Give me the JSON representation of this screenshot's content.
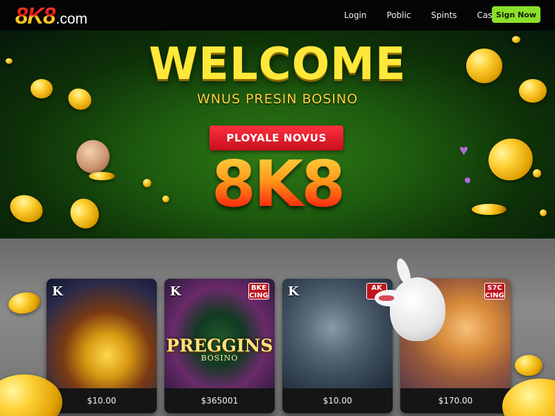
{
  "header": {
    "logo_main": "8K8",
    "logo_suffix": ".com",
    "nav": [
      "Login",
      "Poblic",
      "Spints",
      "Casinus"
    ],
    "signup_label": "Sign Now"
  },
  "hero": {
    "title": "WELCOME",
    "subtitle": "WNUS PRESIN BOSINO",
    "promo_button": "PLOYALE NOVUS",
    "brand": "8K8"
  },
  "games": [
    {
      "corner": "K",
      "badge": "",
      "title": "",
      "subtitle": "",
      "price": "$10.00"
    },
    {
      "corner": "K",
      "badge": "BKE\nCING",
      "title": "PREGGINS",
      "subtitle": "BOSINO",
      "price": "$365001"
    },
    {
      "corner": "K",
      "badge": "AK",
      "title": "",
      "subtitle": "",
      "price": "$10.00"
    },
    {
      "corner": "",
      "badge": "S7C\nCING",
      "title": "",
      "subtitle": "",
      "price": "$170.00"
    }
  ],
  "colors": {
    "signup_bg": "#8be02a",
    "promo_red": "#d8121e",
    "title_yellow": "#ffe83a",
    "hero_green": "#1d5a0e"
  }
}
